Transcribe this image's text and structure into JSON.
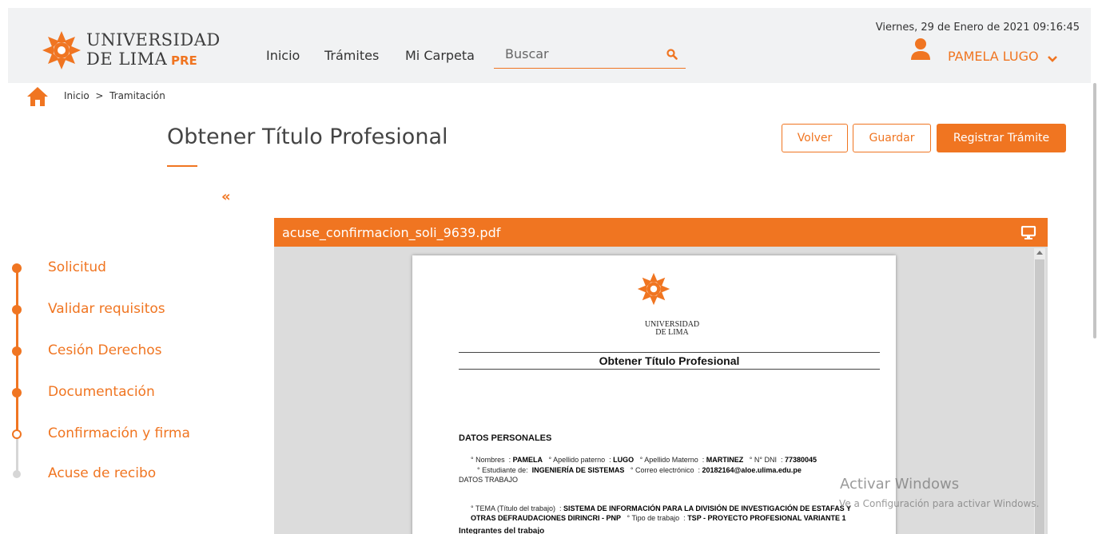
{
  "header": {
    "logo": {
      "line1": "UNIVERSIDAD",
      "line2": "DE LIMA",
      "tag": "PRE"
    },
    "nav": [
      "Inicio",
      "Trámites",
      "Mi Carpeta"
    ],
    "search": {
      "placeholder": "Buscar",
      "icon": "search-icon"
    },
    "datetime": "Viernes, 29 de Enero de 2021 09:16:45",
    "user": {
      "name": "PAMELA LUGO",
      "icon": "user-icon",
      "dropdown_icon": "chevron-down-icon"
    }
  },
  "breadcrumb": {
    "home_icon": "home-icon",
    "text": "Inicio  >  Tramitación"
  },
  "page": {
    "title": "Obtener Título Profesional"
  },
  "actions": {
    "back": "Volver",
    "save": "Guardar",
    "register": "Registrar Trámite"
  },
  "sidebar": {
    "collapse": "«",
    "steps": [
      {
        "label": "Solicitud",
        "state": "done"
      },
      {
        "label": "Validar requisitos",
        "state": "done"
      },
      {
        "label": "Cesión Derechos",
        "state": "done"
      },
      {
        "label": "Documentación",
        "state": "done"
      },
      {
        "label": "Confirmación y firma",
        "state": "current"
      },
      {
        "label": "Acuse de recibo",
        "state": "pending"
      }
    ]
  },
  "viewer": {
    "filename": "acuse_confirmacion_soli_9639.pdf",
    "icon": "monitor-icon",
    "document": {
      "logo_line1": "UNIVERSIDAD",
      "logo_line2": "DE LIMA",
      "title": "Obtener Título Profesional",
      "section_personal": "DATOS PERSONALES",
      "personal_row1": [
        {
          "label": "° Nombres  : ",
          "value": "PAMELA"
        },
        {
          "label": "   ° Apellido paterno  : ",
          "value": "LUGO"
        },
        {
          "label": "   ° Apellido Materno  : ",
          "value": "MARTINEZ"
        },
        {
          "label": "   ° N° DNI  : ",
          "value": "77380045"
        }
      ],
      "personal_row2": [
        {
          "label": "° Estudiante de:  ",
          "value": "INGENIERÍA DE SISTEMAS"
        },
        {
          "label": "   ° Correo electrónico  : ",
          "value": "20182164@aloe.ulima.edu.pe"
        }
      ],
      "section_work": "DATOS TRABAJO",
      "work_row1": [
        {
          "label": "° TEMA (Título del trabajo)  : ",
          "value": "SISTEMA DE INFORMACIÓN PARA LA DIVISIÓN DE INVESTIGACIÓN DE ESTAFAS Y"
        }
      ],
      "work_row2": [
        {
          "label": "",
          "value": "OTRAS DEFRAUDACIONES DIRINCRI - PNP"
        },
        {
          "label": "   ° Tipo de trabajo  : ",
          "value": "TSP - PROYECTO PROFESIONAL VARIANTE 1"
        }
      ],
      "section_members": "Integrantes del trabajo"
    }
  },
  "watermark": {
    "line1": "Activar Windows",
    "line2": "Ve a Configuración para activar Windows."
  },
  "colors": {
    "accent": "#f07521",
    "header_bg": "#f1f2f3",
    "viewer_bg": "#dcdcdc"
  }
}
